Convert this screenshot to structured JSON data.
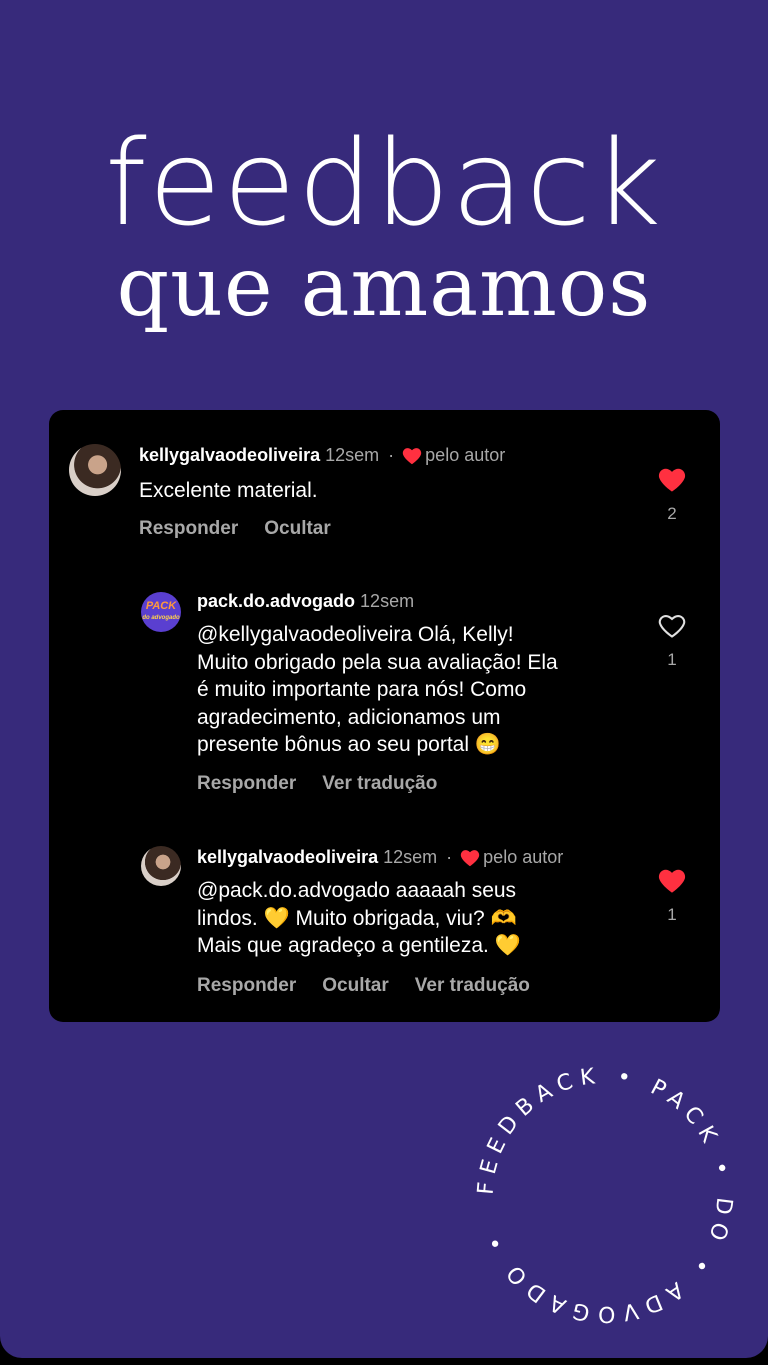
{
  "header": {
    "line1": "feedback",
    "line2": "que amamos"
  },
  "comments": [
    {
      "user": "kellygalvaodeoliveira",
      "time": "12sem",
      "separator": "·",
      "author_tag": "pelo autor",
      "text": "Excelente material.",
      "actions": [
        "Responder",
        "Ocultar"
      ],
      "likes": "2",
      "liked": true
    },
    {
      "user": "pack.do.advogado",
      "time": "12sem",
      "text_lines": [
        "@kellygalvaodeoliveira Olá, Kelly!",
        "Muito obrigado pela sua avaliação! Ela",
        "é muito importante para nós! Como",
        "agradecimento, adicionamos um",
        "presente bônus ao seu portal 😁"
      ],
      "actions": [
        "Responder",
        "Ver tradução"
      ],
      "likes": "1",
      "liked": false,
      "avatar_text": [
        "PACK",
        "do advogado"
      ]
    },
    {
      "user": "kellygalvaodeoliveira",
      "time": "12sem",
      "separator": "·",
      "author_tag": "pelo autor",
      "text_lines": [
        "@pack.do.advogado aaaaah seus",
        "lindos. 💛  Muito obrigada, viu? 🫶",
        "Mais que agradeço a gentileza. 💛"
      ],
      "actions": [
        "Responder",
        "Ocultar",
        "Ver tradução"
      ],
      "likes": "1",
      "liked": true
    }
  ],
  "badge": {
    "text": "FEEDBACK • PACK • DO • ADVOGADO •"
  },
  "colors": {
    "background": "#372a7b",
    "card": "#000000",
    "heart": "#ff3040",
    "muted": "#a8a8a8"
  }
}
